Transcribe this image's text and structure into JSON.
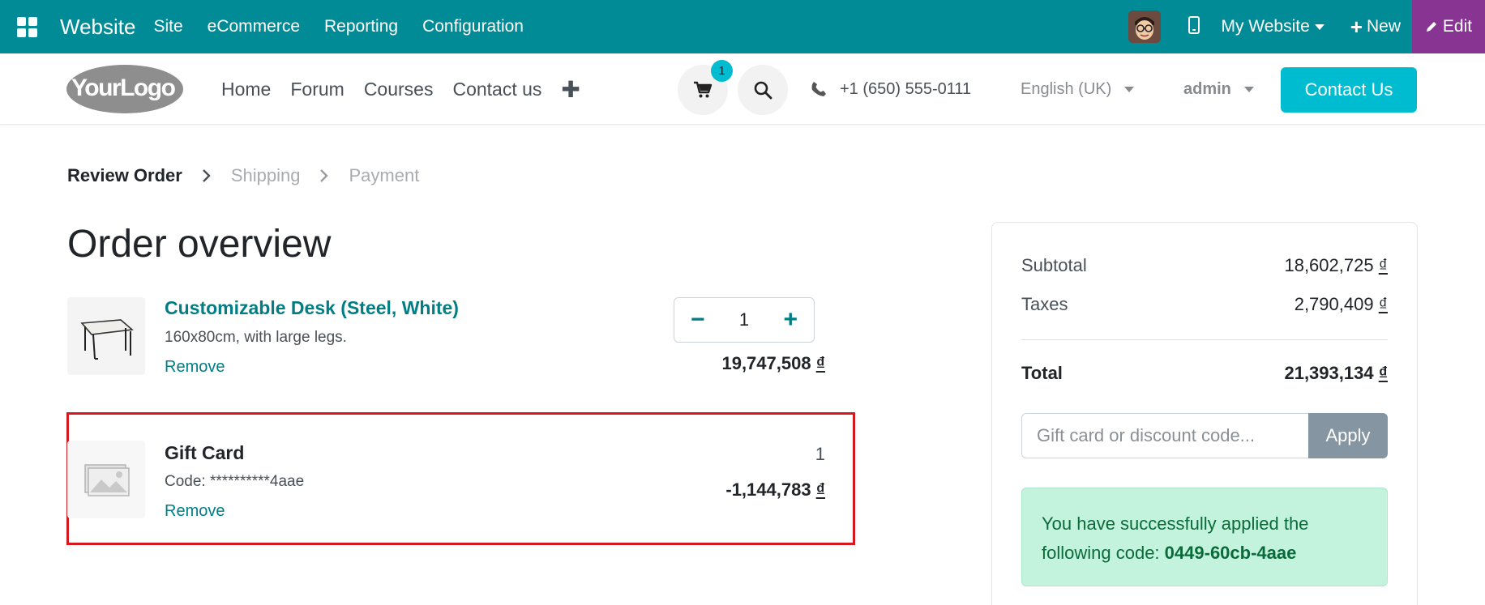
{
  "topbar": {
    "brand": "Website",
    "menu": [
      "Site",
      "eCommerce",
      "Reporting",
      "Configuration"
    ],
    "site_select": "My Website",
    "new_label": "New",
    "edit_label": "Edit",
    "accent_color": "#018b96",
    "edit_color": "#873493"
  },
  "header": {
    "logo": "YourLogo",
    "nav": [
      "Home",
      "Forum",
      "Courses",
      "Contact us"
    ],
    "cart_count": "1",
    "phone": "+1 (650) 555-0111",
    "language": "English (UK)",
    "user": "admin",
    "contact_button": "Contact Us",
    "contact_color": "#00bcd1"
  },
  "wizard": {
    "steps": [
      "Review Order",
      "Shipping",
      "Payment"
    ],
    "active": 0
  },
  "page_title": "Order overview",
  "lines": [
    {
      "name": "Customizable Desk (Steel, White)",
      "description": "160x80cm, with large legs.",
      "remove": "Remove",
      "quantity": "1",
      "price": "19,747,508",
      "currency": "₫"
    },
    {
      "name": "Gift Card",
      "description": "Code: **********4aae",
      "remove": "Remove",
      "quantity": "1",
      "price": "-1,144,783",
      "currency": "₫"
    }
  ],
  "summary": {
    "subtotal_label": "Subtotal",
    "subtotal": "18,602,725",
    "taxes_label": "Taxes",
    "taxes": "2,790,409",
    "total_label": "Total",
    "total": "21,393,134",
    "currency": "₫",
    "promo_placeholder": "Gift card or discount code...",
    "apply_label": "Apply",
    "success_text": "You have successfully applied the following code:",
    "success_code": "0449-60cb-4aae"
  }
}
